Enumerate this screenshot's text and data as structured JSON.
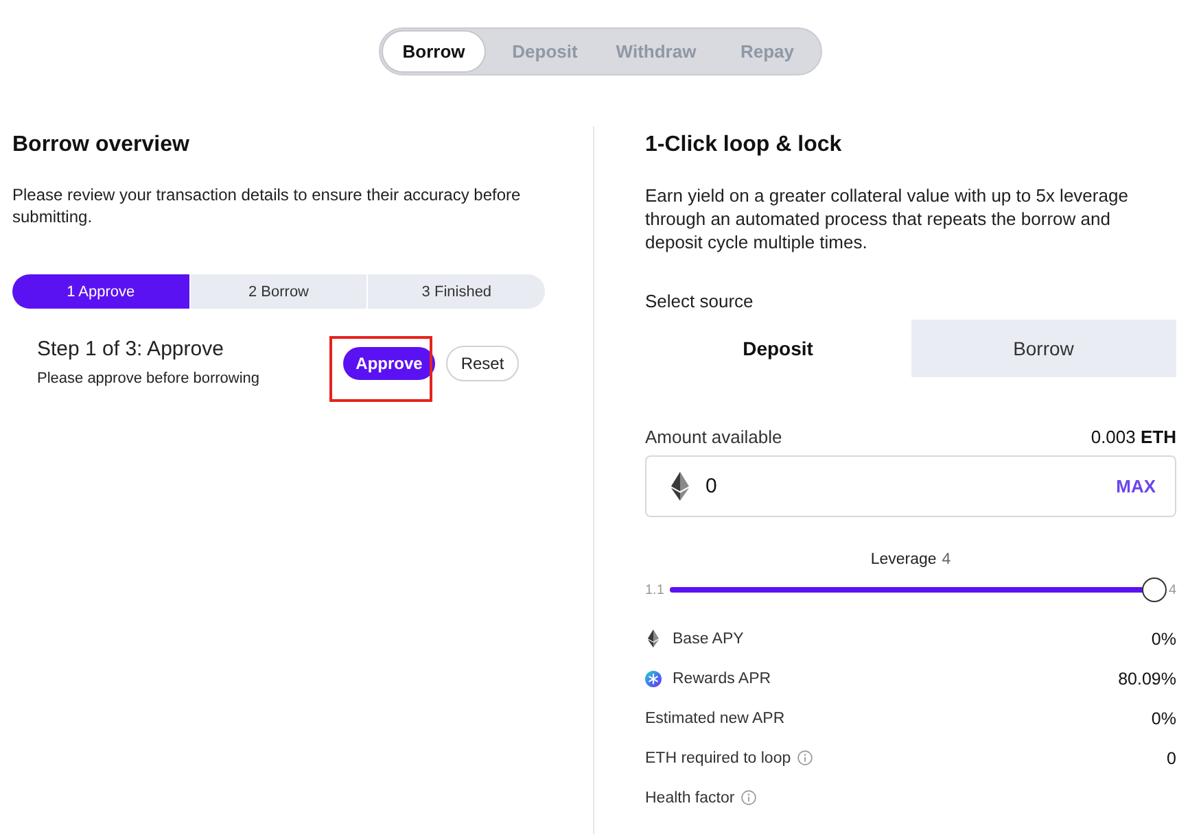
{
  "mode_tabs": [
    {
      "label": "Borrow",
      "selected": true
    },
    {
      "label": "Deposit",
      "selected": false
    },
    {
      "label": "Withdraw",
      "selected": false
    },
    {
      "label": "Repay",
      "selected": false
    }
  ],
  "overview": {
    "title": "Borrow overview",
    "description": "Please review your transaction details to ensure their accuracy before submitting.",
    "steps": [
      {
        "label": "1 Approve",
        "selected": true
      },
      {
        "label": "2 Borrow",
        "selected": false
      },
      {
        "label": "3 Finished",
        "selected": false
      }
    ],
    "step_title": "Step 1 of 3: Approve",
    "step_hint": "Please approve before borrowing",
    "actions": [
      {
        "label": "Approve",
        "kind": "primary",
        "highlighted": true
      },
      {
        "label": "Reset",
        "kind": "secondary",
        "highlighted": false
      }
    ]
  },
  "loop": {
    "title": "1-Click loop & lock",
    "description": "Earn yield on a greater collateral value with up to 5x leverage through an automated process that repeats the borrow and deposit cycle multiple times.",
    "source_label": "Select source",
    "sources": [
      {
        "label": "Deposit",
        "selected": true
      },
      {
        "label": "Borrow",
        "selected": false
      }
    ],
    "amount_label": "Amount available",
    "available": "0.003 **ETH**",
    "amount_input": {
      "value": "0",
      "action": "MAX"
    },
    "leverage": {
      "label": "Leverage",
      "value": "4",
      "min_label": "1.1",
      "max_label": "4",
      "level": 1
    }
  },
  "stats": [
    {
      "kind": "base",
      "label": "Base APY",
      "value": "0%"
    },
    {
      "kind": "rewards",
      "label": "Rewards APR",
      "value": "80.09%"
    },
    {
      "kind": "plain",
      "label": "Estimated new APR",
      "value": "0%"
    },
    {
      "kind": "hint",
      "label": "ETH required to loop",
      "value": "0"
    },
    {
      "kind": "hint",
      "label": "Health factor"
    }
  ]
}
